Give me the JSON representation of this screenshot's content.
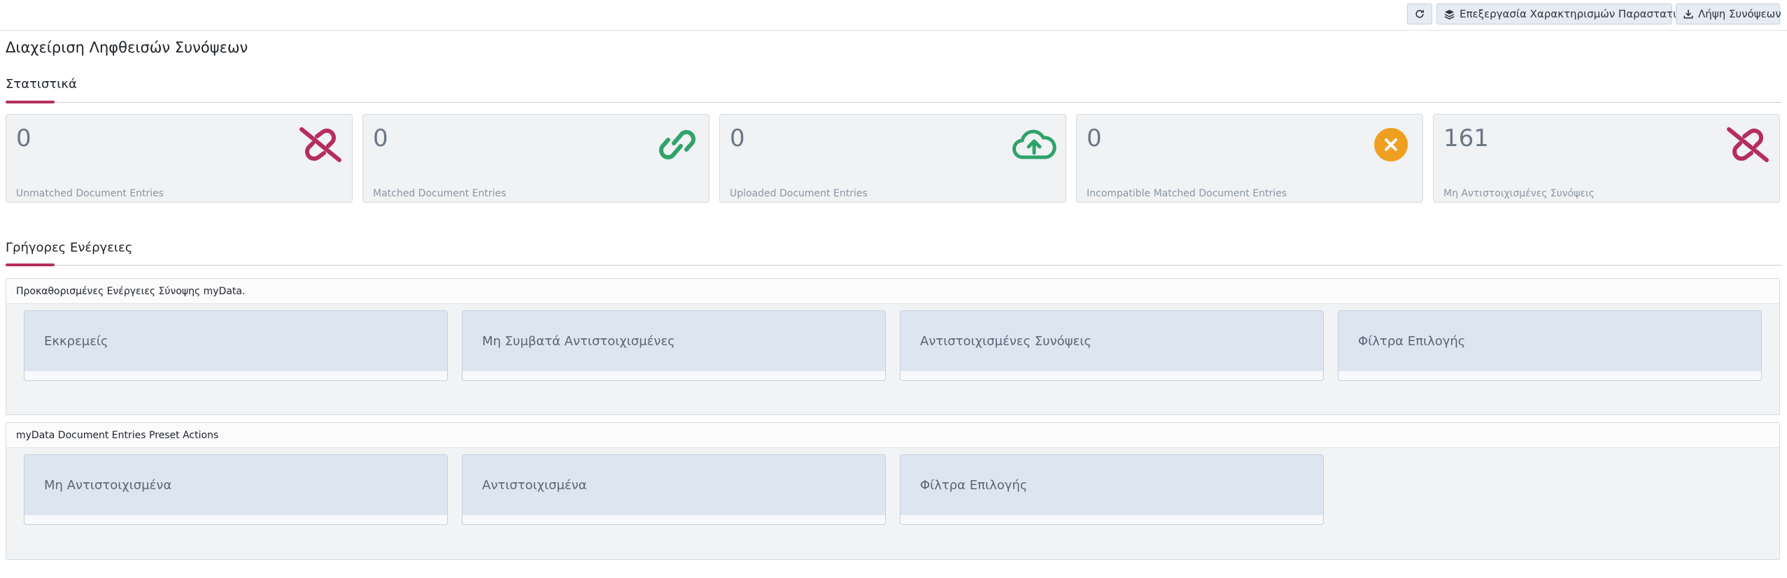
{
  "toolbar": {
    "refresh_icon": "refresh-icon",
    "edit_label": "Επεξεργασία Χαρακτηρισμών Παραστατικών",
    "edit_icon": "layers-icon",
    "download_label": "Λήψη Συνόψεων",
    "download_icon": "download-icon"
  },
  "page": {
    "title": "Διαχείριση Ληφθεισών Συνόψεων"
  },
  "stats": {
    "title": "Στατιστικά",
    "cards": [
      {
        "value": "0",
        "label": "Unmatched Document Entries",
        "icon": "unlink-icon",
        "color": "#b52d5e"
      },
      {
        "value": "0",
        "label": "Matched Document Entries",
        "icon": "link-icon",
        "color": "#2fa36b"
      },
      {
        "value": "0",
        "label": "Uploaded Document Entries",
        "icon": "cloud-upload-icon",
        "color": "#2fa36b"
      },
      {
        "value": "0",
        "label": "Incompatible Matched Document Entries",
        "icon": "x-circle-icon",
        "color": "#f0a020"
      },
      {
        "value": "161",
        "label": "Μη Αντιστοιχισμένες Συνόψεις",
        "icon": "unlink-icon",
        "color": "#b52d5e"
      }
    ]
  },
  "quick_actions": {
    "title": "Γρήγορες Ενέργειες",
    "panels": [
      {
        "title": "Προκαθορισμένες Ενέργειες Σύνοψης myData.",
        "actions": [
          "Εκκρεμείς",
          "Μη Συμβατά Αντιστοιχισμένες",
          "Αντιστοιχισμένες Συνόψεις",
          "Φίλτρα Επιλογής"
        ]
      },
      {
        "title": "myData Document Entries Preset Actions",
        "actions": [
          "Μη Αντιστοιχισμένα",
          "Αντιστοιχισμένα",
          "Φίλτρα Επιλογής"
        ]
      }
    ]
  }
}
